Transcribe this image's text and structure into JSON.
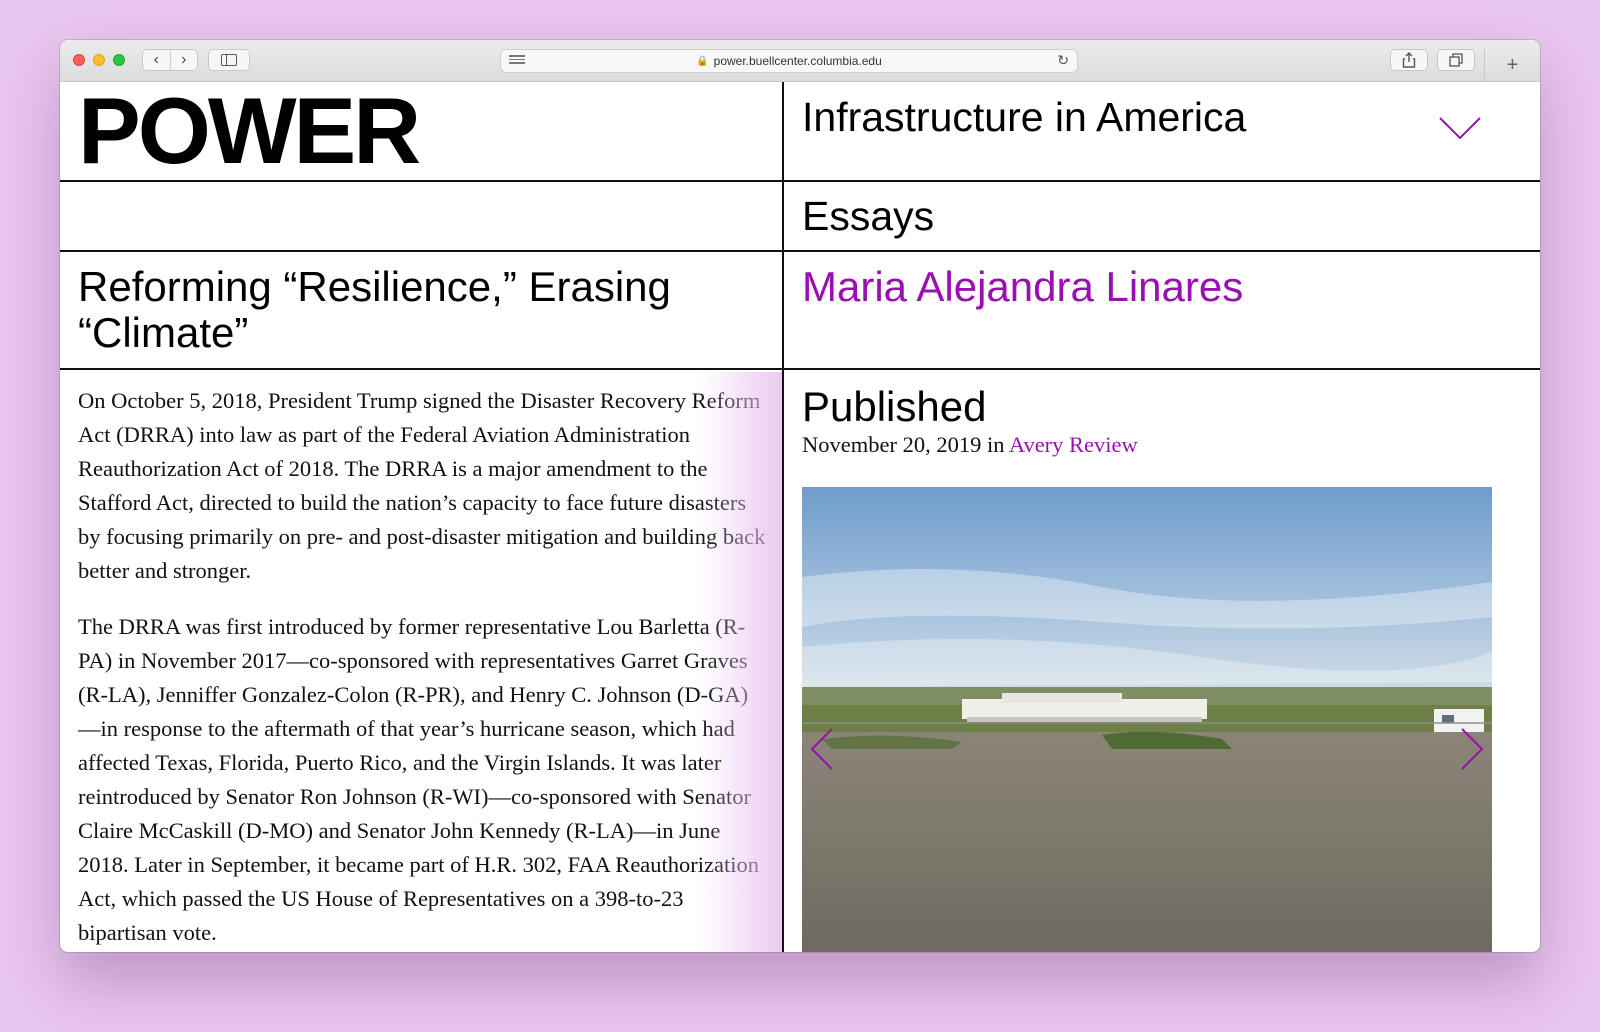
{
  "browser": {
    "url": "power.buellcenter.columbia.edu",
    "back_icon": "chevron-left",
    "forward_icon": "chevron-right",
    "new_tab_label": "+"
  },
  "site": {
    "logo": "POWER",
    "series_title": "Infrastructure in America",
    "section": "Essays"
  },
  "essay": {
    "title": "Reforming “Resilience,” Erasing “Climate”",
    "author": "Maria Alejandra Linares",
    "paragraphs": [
      "On October 5, 2018, President Trump signed the Disaster Recovery Reform Act (DRRA) into law as part of the Federal Aviation Administration Reauthorization Act of 2018. The DRRA is a major amendment to the Stafford Act, directed to build the nation’s capacity to face future disasters by focusing primarily on pre- and post-disaster mitigation and building back better and stronger.",
      "The DRRA was first introduced by former representative Lou Barletta (R-PA) in November 2017—co-sponsored with representatives Garret Graves (R-LA), Jenniffer Gonzalez-Colon (R-PR), and Henry C. Johnson (D-GA)—in response to the aftermath of that year’s hurricane season, which had affected Texas, Florida, Puerto Rico, and the Virgin Islands. It was later reintroduced by Senator Ron Johnson (R-WI)—co-sponsored with Senator Claire McCaskill (D-MO) and Senator John Kennedy (R-LA)—in June 2018. Later in September, it became part of H.R. 302, FAA Reauthorization Act, which passed the US House of Representatives on a 398-to-23 bipartisan vote."
    ]
  },
  "publication": {
    "label": "Published",
    "date": "November 20, 2019",
    "in_word": " in ",
    "venue": "Avery Review"
  },
  "colors": {
    "accent": "#9a0fb1",
    "background": "#e9c6ef",
    "rule": "#111111"
  }
}
